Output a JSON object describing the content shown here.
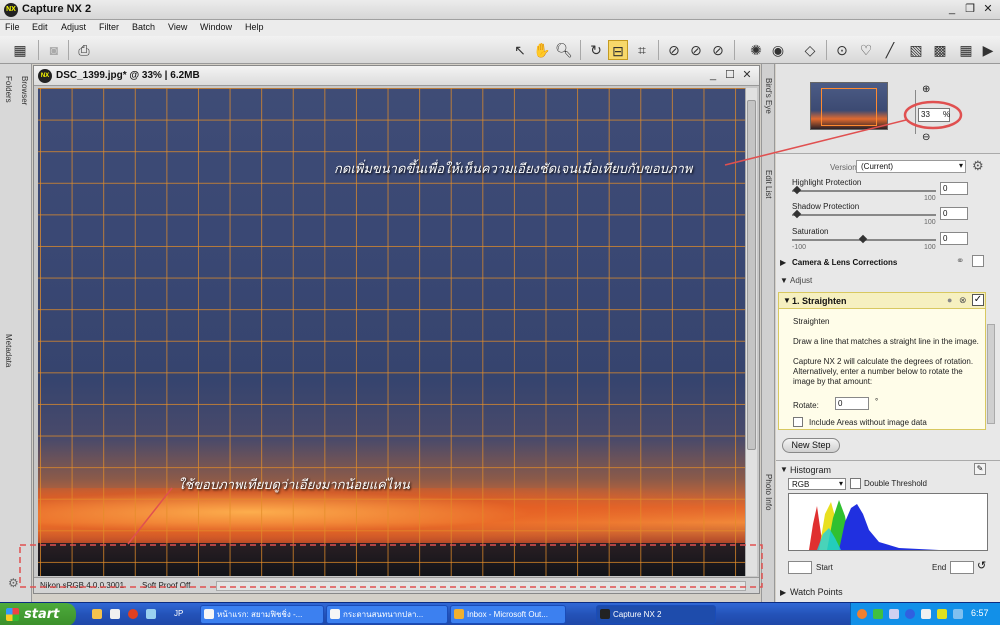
{
  "window": {
    "title": "Capture NX 2",
    "min": "_",
    "restore": "❐",
    "close": "✕"
  },
  "menu": [
    "File",
    "Edit",
    "Adjust",
    "Filter",
    "Batch",
    "View",
    "Window",
    "Help"
  ],
  "document": {
    "title": "DSC_1399.jpg* @ 33% | 6.2MB",
    "color_profile": "Nikon sRGB 4.0.0.3001",
    "soft_proof": "Soft Proof Off"
  },
  "side_tabs": {
    "folders": "Folders",
    "browser": "Browser",
    "metadata": "Metadata"
  },
  "right_tabs": {
    "birds_eye": "Bird's Eye",
    "edit_list": "Edit List",
    "photo_info": "Photo Info"
  },
  "annotations": {
    "top": "กดเพิ่มขนาดขึ้นเพื่อให้เห็นความเอียงชัดเจนเมื่อเทียบกับขอบภาพ",
    "bottom": "ใช้ขอบภาพเทียบดูว่าเอียงมากน้อยแค่ไหน"
  },
  "birds_eye": {
    "zoom_value": "33",
    "zoom_unit": "%"
  },
  "edit_list": {
    "version_label": "Version",
    "version_value": "(Current)",
    "highlight_protection": {
      "label": "Highlight Protection",
      "value": "0",
      "max": "100"
    },
    "shadow_protection": {
      "label": "Shadow Protection",
      "value": "0",
      "max": "100"
    },
    "saturation": {
      "label": "Saturation",
      "value": "0",
      "min": "-100",
      "max": "100"
    },
    "camera_lens": "Camera & Lens Corrections",
    "adjust_header": "Adjust",
    "straighten": {
      "step_title": "1. Straighten",
      "name": "Straighten",
      "desc1": "Draw a line that matches a straight line in the image.",
      "desc2": "Capture NX 2 will calculate the degrees of rotation.",
      "desc3": "Alternatively, enter a number below to rotate the image by that amount:",
      "rotate_label": "Rotate:",
      "rotate_value": "0",
      "rotate_unit": "°",
      "include_areas": "Include Areas without image data"
    },
    "new_step": "New Step"
  },
  "histogram": {
    "header": "Histogram",
    "channel": "RGB",
    "double_threshold": "Double Threshold",
    "start_label": "Start",
    "end_label": "End"
  },
  "watch_points": "Watch Points",
  "taskbar": {
    "start": "start",
    "lang": "JP",
    "tasks": [
      "หน้าแรก: สยามฟิชชิ่ง -...",
      "กระดานสนทนากปลา...",
      "Inbox - Microsoft Out...",
      "Capture NX 2"
    ],
    "clock": "6:57"
  },
  "colors": {
    "accent_highlight": "#e05050",
    "grid": "#e28c28",
    "taskbar": "#2453b9"
  }
}
